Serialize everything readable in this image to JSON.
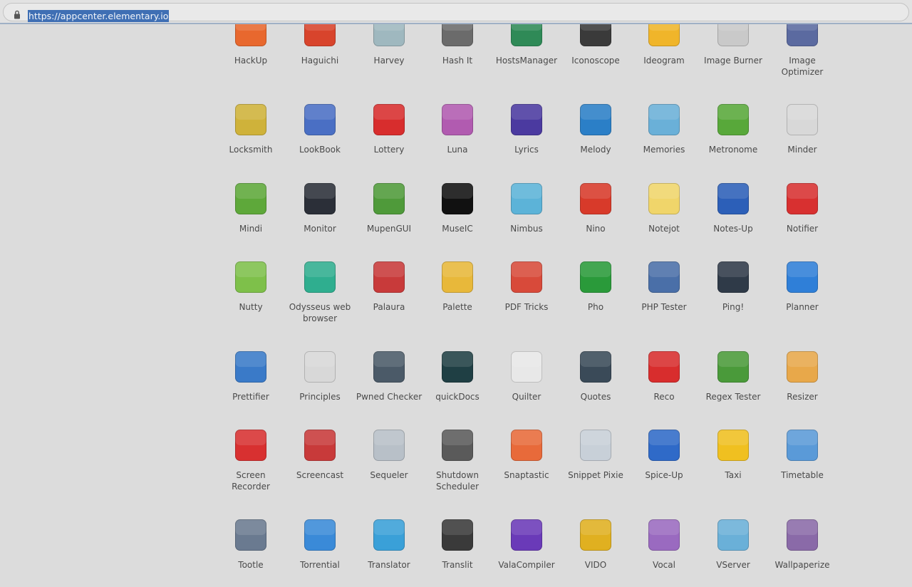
{
  "browser": {
    "url": "https://appcenter.elementary.io"
  },
  "apps": [
    {
      "name": "HackUp",
      "icon": "hackup-icon",
      "color": "#e8682e"
    },
    {
      "name": "Haguichi",
      "icon": "haguichi-icon",
      "color": "#d8442c"
    },
    {
      "name": "Harvey",
      "icon": "harvey-icon",
      "color": "#9fb8bf"
    },
    {
      "name": "Hash It",
      "icon": "hash-it-icon",
      "color": "#6b6b6b"
    },
    {
      "name": "HostsManager",
      "icon": "hostsmanager-icon",
      "color": "#2f8a57"
    },
    {
      "name": "Iconoscope",
      "icon": "iconoscope-icon",
      "color": "#3a3a3a"
    },
    {
      "name": "Ideogram",
      "icon": "ideogram-icon",
      "color": "#f0b52a"
    },
    {
      "name": "Image Burner",
      "icon": "image-burner-icon",
      "color": "#c9c9c9"
    },
    {
      "name": "Image\nOptimizer",
      "icon": "image-optimizer-icon",
      "color": "#5b6aa0"
    },
    {
      "name": "Locksmith",
      "icon": "locksmith-icon",
      "color": "#cfb23a"
    },
    {
      "name": "LookBook",
      "icon": "lookbook-icon",
      "color": "#4a6fc4"
    },
    {
      "name": "Lottery",
      "icon": "lottery-icon",
      "color": "#d82d2d"
    },
    {
      "name": "Luna",
      "icon": "luna-icon",
      "color": "#b15bb0"
    },
    {
      "name": "Lyrics",
      "icon": "lyrics-icon",
      "color": "#4b3aa0"
    },
    {
      "name": "Melody",
      "icon": "melody-icon",
      "color": "#2b7fc7"
    },
    {
      "name": "Memories",
      "icon": "memories-icon",
      "color": "#6ab0d8"
    },
    {
      "name": "Metronome",
      "icon": "metronome-icon",
      "color": "#58a83a"
    },
    {
      "name": "Minder",
      "icon": "minder-icon",
      "color": "#d8d8d8"
    },
    {
      "name": "Mindi",
      "icon": "mindi-icon",
      "color": "#5ea83a"
    },
    {
      "name": "Monitor",
      "icon": "monitor-icon",
      "color": "#2b2f38"
    },
    {
      "name": "MupenGUI",
      "icon": "mupengui-icon",
      "color": "#4f9a3a"
    },
    {
      "name": "MuseIC",
      "icon": "museic-icon",
      "color": "#111111"
    },
    {
      "name": "Nimbus",
      "icon": "nimbus-icon",
      "color": "#5cb3d8"
    },
    {
      "name": "Nino",
      "icon": "nino-icon",
      "color": "#d83a2a"
    },
    {
      "name": "Notejot",
      "icon": "notejot-icon",
      "color": "#f0d56a"
    },
    {
      "name": "Notes-Up",
      "icon": "notes-up-icon",
      "color": "#2c5fb8"
    },
    {
      "name": "Notifier",
      "icon": "notifier-icon",
      "color": "#d83030"
    },
    {
      "name": "Nutty",
      "icon": "nutty-icon",
      "color": "#7ec04a"
    },
    {
      "name": "Odysseus web\nbrowser",
      "icon": "odysseus-icon",
      "color": "#2fae8f"
    },
    {
      "name": "Palaura",
      "icon": "palaura-icon",
      "color": "#c83a3a"
    },
    {
      "name": "Palette",
      "icon": "palette-icon",
      "color": "#e8b83a"
    },
    {
      "name": "PDF Tricks",
      "icon": "pdf-tricks-icon",
      "color": "#d84a3a"
    },
    {
      "name": "Pho",
      "icon": "pho-icon",
      "color": "#2a9a3a"
    },
    {
      "name": "PHP Tester",
      "icon": "php-tester-icon",
      "color": "#4a6fa8"
    },
    {
      "name": "Ping!",
      "icon": "ping-icon",
      "color": "#2f3a48"
    },
    {
      "name": "Planner",
      "icon": "planner-icon",
      "color": "#2f7fd8"
    },
    {
      "name": "Prettifier",
      "icon": "prettifier-icon",
      "color": "#3a7ac8"
    },
    {
      "name": "Principles",
      "icon": "principles-icon",
      "color": "#d8d8d8"
    },
    {
      "name": "Pwned Checker",
      "icon": "pwned-checker-icon",
      "color": "#4b5a68"
    },
    {
      "name": "quickDocs",
      "icon": "quickdocs-icon",
      "color": "#1f3f44"
    },
    {
      "name": "Quilter",
      "icon": "quilter-icon",
      "color": "#e8e8e8"
    },
    {
      "name": "Quotes",
      "icon": "quotes-icon",
      "color": "#3a4a58"
    },
    {
      "name": "Reco",
      "icon": "reco-icon",
      "color": "#d82d2d"
    },
    {
      "name": "Regex Tester",
      "icon": "regex-tester-icon",
      "color": "#4a9a3a"
    },
    {
      "name": "Resizer",
      "icon": "resizer-icon",
      "color": "#e8a84a"
    },
    {
      "name": "Screen\nRecorder",
      "icon": "screen-recorder-icon",
      "color": "#d83030"
    },
    {
      "name": "Screencast",
      "icon": "screencast-icon",
      "color": "#c83a3a"
    },
    {
      "name": "Sequeler",
      "icon": "sequeler-icon",
      "color": "#b8c0c8"
    },
    {
      "name": "Shutdown\nScheduler",
      "icon": "shutdown-scheduler-icon",
      "color": "#5a5a5a"
    },
    {
      "name": "Snaptastic",
      "icon": "snaptastic-icon",
      "color": "#e86a3a"
    },
    {
      "name": "Snippet Pixie",
      "icon": "snippet-pixie-icon",
      "color": "#c8d0d8"
    },
    {
      "name": "Spice-Up",
      "icon": "spice-up-icon",
      "color": "#2f6ac8"
    },
    {
      "name": "Taxi",
      "icon": "taxi-icon",
      "color": "#f0c020"
    },
    {
      "name": "Timetable",
      "icon": "timetable-icon",
      "color": "#5a9ad8"
    },
    {
      "name": "Tootle",
      "icon": "tootle-icon",
      "color": "#6a7a90"
    },
    {
      "name": "Torrential",
      "icon": "torrential-icon",
      "color": "#3a8ad8"
    },
    {
      "name": "Translator",
      "icon": "translator-icon",
      "color": "#3aa0d8"
    },
    {
      "name": "Translit",
      "icon": "translit-icon",
      "color": "#3a3a3a"
    },
    {
      "name": "ValaCompiler",
      "icon": "valacompiler-icon",
      "color": "#6a3ab8"
    },
    {
      "name": "VIDO",
      "icon": "vido-icon",
      "color": "#e0b020"
    },
    {
      "name": "Vocal",
      "icon": "vocal-icon",
      "color": "#9a6ac0"
    },
    {
      "name": "VServer",
      "icon": "vserver-icon",
      "color": "#6ab0d8"
    },
    {
      "name": "Wallpaperize",
      "icon": "wallpaperize-icon",
      "color": "#8a6aa8"
    }
  ]
}
